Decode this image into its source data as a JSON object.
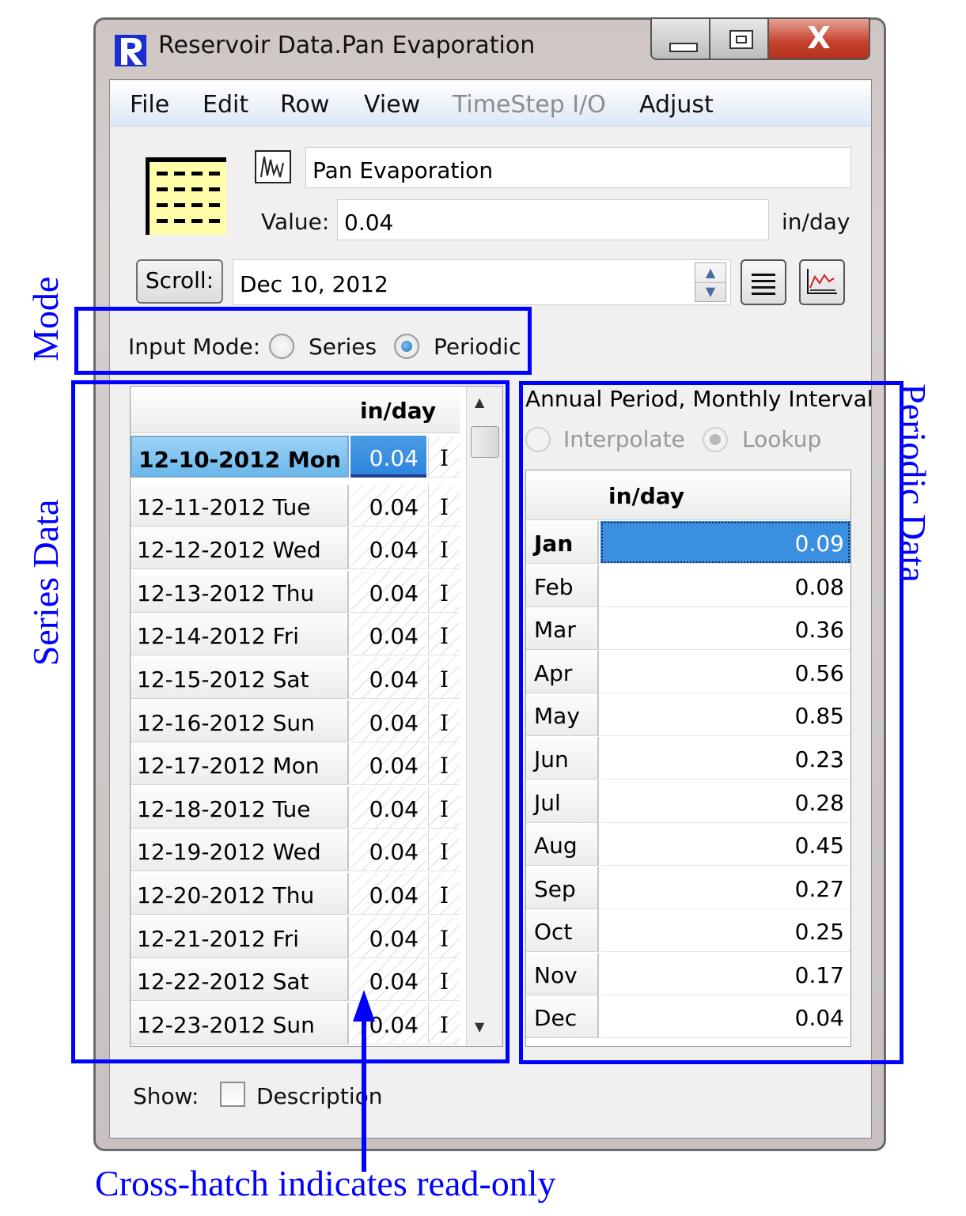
{
  "window": {
    "title": "Reservoir Data.Pan Evaporation",
    "close_glyph": "X"
  },
  "menu": [
    "File",
    "Edit",
    "Row",
    "View",
    "TimeStep I/O",
    "Adjust"
  ],
  "header": {
    "name": "Pan Evaporation",
    "value_label": "Value:",
    "value": "0.04",
    "units": "in/day",
    "scroll_label": "Scroll:",
    "date": "Dec 10, 2012"
  },
  "input_mode": {
    "label": "Input Mode:",
    "series_label": "Series",
    "periodic_label": "Periodic",
    "selected": "Periodic"
  },
  "series_table": {
    "unit_header": "in/day",
    "rows": [
      {
        "date": "12-10-2012 Mon",
        "value": "0.04",
        "flag": "I"
      },
      {
        "date": "12-11-2012 Tue",
        "value": "0.04",
        "flag": "I"
      },
      {
        "date": "12-12-2012 Wed",
        "value": "0.04",
        "flag": "I"
      },
      {
        "date": "12-13-2012 Thu",
        "value": "0.04",
        "flag": "I"
      },
      {
        "date": "12-14-2012 Fri",
        "value": "0.04",
        "flag": "I"
      },
      {
        "date": "12-15-2012 Sat",
        "value": "0.04",
        "flag": "I"
      },
      {
        "date": "12-16-2012 Sun",
        "value": "0.04",
        "flag": "I"
      },
      {
        "date": "12-17-2012 Mon",
        "value": "0.04",
        "flag": "I"
      },
      {
        "date": "12-18-2012 Tue",
        "value": "0.04",
        "flag": "I"
      },
      {
        "date": "12-19-2012 Wed",
        "value": "0.04",
        "flag": "I"
      },
      {
        "date": "12-20-2012 Thu",
        "value": "0.04",
        "flag": "I"
      },
      {
        "date": "12-21-2012 Fri",
        "value": "0.04",
        "flag": "I"
      },
      {
        "date": "12-22-2012 Sat",
        "value": "0.04",
        "flag": "I"
      },
      {
        "date": "12-23-2012 Sun",
        "value": "0.04",
        "flag": "I"
      }
    ]
  },
  "periodic": {
    "title": "Annual Period, Monthly Interval",
    "interpolate_label": "Interpolate",
    "lookup_label": "Lookup",
    "unit_header": "in/day",
    "rows": [
      {
        "month": "Jan",
        "value": "0.09"
      },
      {
        "month": "Feb",
        "value": "0.08"
      },
      {
        "month": "Mar",
        "value": "0.36"
      },
      {
        "month": "Apr",
        "value": "0.56"
      },
      {
        "month": "May",
        "value": "0.85"
      },
      {
        "month": "Jun",
        "value": "0.23"
      },
      {
        "month": "Jul",
        "value": "0.28"
      },
      {
        "month": "Aug",
        "value": "0.45"
      },
      {
        "month": "Sep",
        "value": "0.27"
      },
      {
        "month": "Oct",
        "value": "0.25"
      },
      {
        "month": "Nov",
        "value": "0.17"
      },
      {
        "month": "Dec",
        "value": "0.04"
      }
    ]
  },
  "footer": {
    "show_label": "Show:",
    "description_label": "Description",
    "description_checked": false
  },
  "annotations": {
    "mode": "Mode",
    "series_data": "Series Data",
    "periodic_data": "Periodic Data",
    "cross_hatch": "Cross-hatch indicates read-only"
  },
  "colors": {
    "annotation": "#0000ff",
    "selection": "#3a8fe0",
    "close_button": "#c4402b",
    "menubar": "#dce7f6"
  }
}
